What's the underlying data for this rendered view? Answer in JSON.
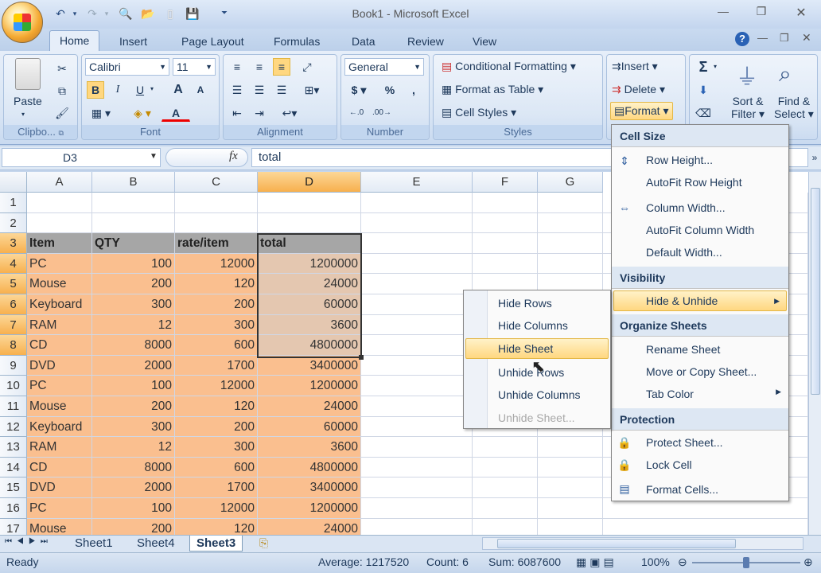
{
  "window": {
    "title": "Book1 - Microsoft Excel"
  },
  "tabs": [
    "Home",
    "Insert",
    "Page Layout",
    "Formulas",
    "Data",
    "Review",
    "View"
  ],
  "ribbon": {
    "clipboard": {
      "label": "Clipbo...",
      "paste": "Paste"
    },
    "font": {
      "label": "Font",
      "name": "Calibri",
      "size": "11",
      "bold": "B",
      "italic": "I",
      "underline": "U",
      "grow": "A",
      "shrink": "A",
      "fontcolor": "A"
    },
    "alignment": {
      "label": "Alignment"
    },
    "number": {
      "label": "Number",
      "format": "General",
      "currency": "$",
      "percent": "%",
      "comma": ","
    },
    "styles": {
      "label": "Styles",
      "conditional": "Conditional Formatting",
      "format_table": "Format as Table",
      "cell_styles": "Cell Styles"
    },
    "cells": {
      "insert": "Insert",
      "delete": "Delete",
      "format": "Format"
    },
    "editing": {
      "sort": "Sort &",
      "sort2": "Filter",
      "find": "Find &",
      "find2": "Select"
    }
  },
  "formula": {
    "namebox": "D3",
    "fx": "fx",
    "value": "total"
  },
  "columns": [
    "A",
    "B",
    "C",
    "D",
    "E",
    "F",
    "G"
  ],
  "rows": [
    {
      "n": "1",
      "a": "",
      "b": "",
      "c": "",
      "d": ""
    },
    {
      "n": "2",
      "a": "",
      "b": "",
      "c": "",
      "d": ""
    },
    {
      "n": "3",
      "a": "Item",
      "b": "QTY",
      "c": "rate/item",
      "d": "total"
    },
    {
      "n": "4",
      "a": "PC",
      "b": "100",
      "c": "12000",
      "d": "1200000"
    },
    {
      "n": "5",
      "a": "Mouse",
      "b": "200",
      "c": "120",
      "d": "24000"
    },
    {
      "n": "6",
      "a": "Keyboard",
      "b": "300",
      "c": "200",
      "d": "60000"
    },
    {
      "n": "7",
      "a": "RAM",
      "b": "12",
      "c": "300",
      "d": "3600"
    },
    {
      "n": "8",
      "a": "CD",
      "b": "8000",
      "c": "600",
      "d": "4800000"
    },
    {
      "n": "9",
      "a": "DVD",
      "b": "2000",
      "c": "1700",
      "d": "3400000"
    },
    {
      "n": "10",
      "a": "PC",
      "b": "100",
      "c": "12000",
      "d": "1200000"
    },
    {
      "n": "11",
      "a": "Mouse",
      "b": "200",
      "c": "120",
      "d": "24000"
    },
    {
      "n": "12",
      "a": "Keyboard",
      "b": "300",
      "c": "200",
      "d": "60000"
    },
    {
      "n": "13",
      "a": "RAM",
      "b": "12",
      "c": "300",
      "d": "3600"
    },
    {
      "n": "14",
      "a": "CD",
      "b": "8000",
      "c": "600",
      "d": "4800000"
    },
    {
      "n": "15",
      "a": "DVD",
      "b": "2000",
      "c": "1700",
      "d": "3400000"
    },
    {
      "n": "16",
      "a": "PC",
      "b": "100",
      "c": "12000",
      "d": "1200000"
    },
    {
      "n": "17",
      "a": "Mouse",
      "b": "200",
      "c": "120",
      "d": "24000"
    }
  ],
  "sheets": [
    "Sheet1",
    "Sheet4",
    "Sheet3"
  ],
  "status": {
    "ready": "Ready",
    "average": "Average: 1217520",
    "count": "Count: 6",
    "sum": "Sum: 6087600",
    "zoom": "100%"
  },
  "format_menu": {
    "cell_size": "Cell Size",
    "row_height": "Row Height...",
    "autofit_row": "AutoFit Row Height",
    "column_width": "Column Width...",
    "autofit_col": "AutoFit Column Width",
    "default_width": "Default Width...",
    "visibility": "Visibility",
    "hide_unhide": "Hide & Unhide",
    "organize": "Organize Sheets",
    "rename": "Rename Sheet",
    "move_copy": "Move or Copy Sheet...",
    "tab_color": "Tab Color",
    "protection": "Protection",
    "protect": "Protect Sheet...",
    "lock": "Lock Cell",
    "format_cells": "Format Cells..."
  },
  "hide_menu": {
    "hide_rows": "Hide Rows",
    "hide_columns": "Hide Columns",
    "hide_sheet": "Hide Sheet",
    "unhide_rows": "Unhide Rows",
    "unhide_columns": "Unhide Columns",
    "unhide_sheet": "Unhide Sheet..."
  }
}
